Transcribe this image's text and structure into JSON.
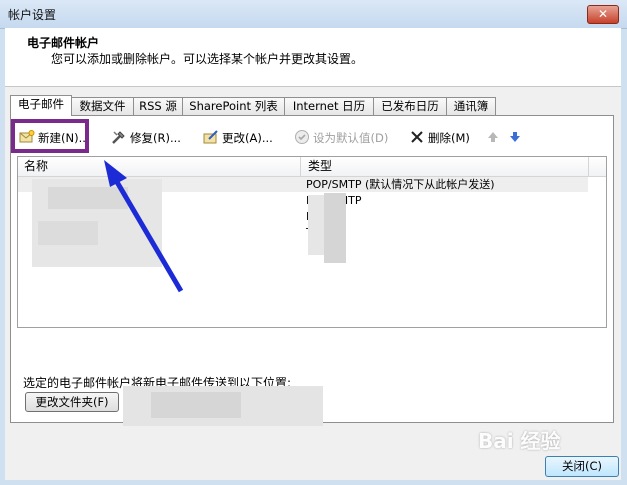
{
  "window": {
    "title": "帐户设置",
    "close_glyph": "✕"
  },
  "header": {
    "title": "电子邮件帐户",
    "subtitle": "您可以添加或删除帐户。可以选择某个帐户并更改其设置。"
  },
  "tabs": [
    {
      "label": "电子邮件",
      "active": true
    },
    {
      "label": "数据文件"
    },
    {
      "label": "RSS 源"
    },
    {
      "label": "SharePoint 列表"
    },
    {
      "label": "Internet 日历"
    },
    {
      "label": "已发布日历"
    },
    {
      "label": "通讯簿"
    }
  ],
  "toolbar": {
    "new": {
      "label": "新建(N)...",
      "icon": "new-account-icon"
    },
    "repair": {
      "label": "修复(R)...",
      "icon": "repair-icon"
    },
    "change": {
      "label": "更改(A)...",
      "icon": "change-icon"
    },
    "set_default": {
      "label": "设为默认值(D)",
      "icon": "checkmark-icon"
    },
    "delete": {
      "label": "删除(M)",
      "icon": "delete-icon"
    },
    "move_up": {
      "icon": "arrow-up-icon"
    },
    "move_down": {
      "icon": "arrow-down-icon"
    }
  },
  "list": {
    "columns": [
      "名称",
      "类型"
    ],
    "rows": [
      {
        "type": "POP/SMTP (默认情况下从此帐户发送)"
      },
      {
        "type": "POP/SMTP"
      },
      {
        "type": "MTP"
      },
      {
        "type": "TP"
      },
      {
        "type": ""
      }
    ]
  },
  "delivery": {
    "label": "选定的电子邮件帐户将新电子邮件传送到以下位置:",
    "change_folder_button": "更改文件夹(F)"
  },
  "close_button": "关闭(C)",
  "watermark": "Bai 经验",
  "colors": {
    "highlight": "#7a2a8a",
    "arrow": "#1c2bd6"
  }
}
